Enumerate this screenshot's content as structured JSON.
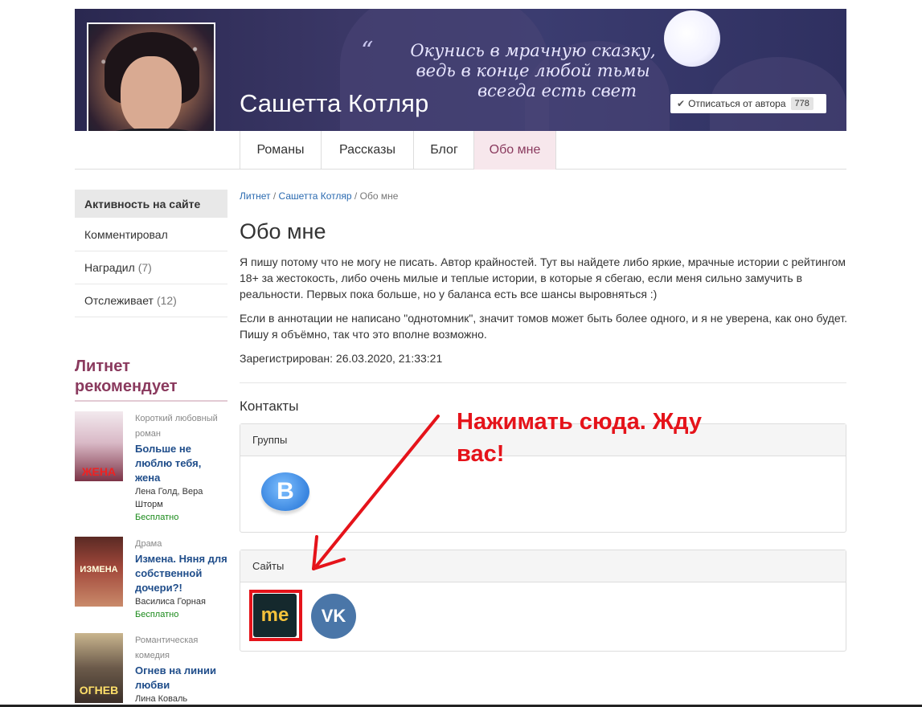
{
  "banner": {
    "quote_line1": "Окунись в мрачную сказку,",
    "quote_line2": "ведь в конце любой тьмы",
    "quote_line3": "всегда есть свет",
    "author_name": "Сашетта Котляр",
    "unsubscribe_label": "Отписаться от автора",
    "subscribers_count": "778"
  },
  "tabs": [
    {
      "label": "Романы"
    },
    {
      "label": "Рассказы"
    },
    {
      "label": "Блог"
    },
    {
      "label": "Обо мне",
      "active": true
    }
  ],
  "sidebar": {
    "heading": "Активность на сайте",
    "items": [
      {
        "label": "Комментировал",
        "count": ""
      },
      {
        "label": "Наградил",
        "count": "(7)"
      },
      {
        "label": "Отслеживает",
        "count": "(12)"
      }
    ]
  },
  "recommend": {
    "title_line1": "Литнет",
    "title_line2": "рекомендует",
    "books": [
      {
        "cover_text": "ЖЕНА",
        "genre": "Короткий любовный роман",
        "title": "Больше не люблю тебя, жена",
        "author": "Лена Голд, Вера Шторм",
        "price": "Бесплатно"
      },
      {
        "cover_text": "ИЗМЕНА",
        "genre": "Драма",
        "title": "Измена. Няня для собственной дочери?!",
        "author": "Василиса Горная",
        "price": "Бесплатно"
      },
      {
        "cover_text": "ОГНЕВ",
        "genre": "Романтическая комедия",
        "title": "Огнев на линии любви",
        "author": "Лина Коваль",
        "price": ""
      }
    ]
  },
  "breadcrumb": {
    "home": "Литнет",
    "author": "Сашетта Котляр",
    "current": "Обо мне",
    "sep": "/"
  },
  "about": {
    "title": "Обо мне",
    "paragraph1": "Я пишу потому что не могу не писать. Автор крайностей. Тут вы найдете либо яркие, мрачные истории с рейтингом 18+ за жестокость, либо очень милые и теплые истории, в которые я сбегаю, если меня сильно замучить в реальности. Первых пока больше, но у баланса есть все шансы выровняться :)",
    "paragraph2": "Если в аннотации не написано \"однотомник\", значит томов может быть более одного, и я не уверена, как оно будет. Пишу я объёмно, так что это вполне возможно.",
    "registered": "Зарегистрирован: 26.03.2020, 21:33:21"
  },
  "contacts": {
    "heading": "Контакты",
    "groups_label": "Группы",
    "sites_label": "Сайты",
    "vk_group_letter": "B",
    "me_logo_text": "me",
    "vk_logo_text": "VK"
  },
  "annotation": {
    "line1": "Нажимать сюда. Жду",
    "line2": "вас!"
  },
  "colors": {
    "accent": "#8a3a5e",
    "link": "#2a6ab0",
    "annotation_red": "#e5131a",
    "free_green": "#1a8a1a"
  }
}
